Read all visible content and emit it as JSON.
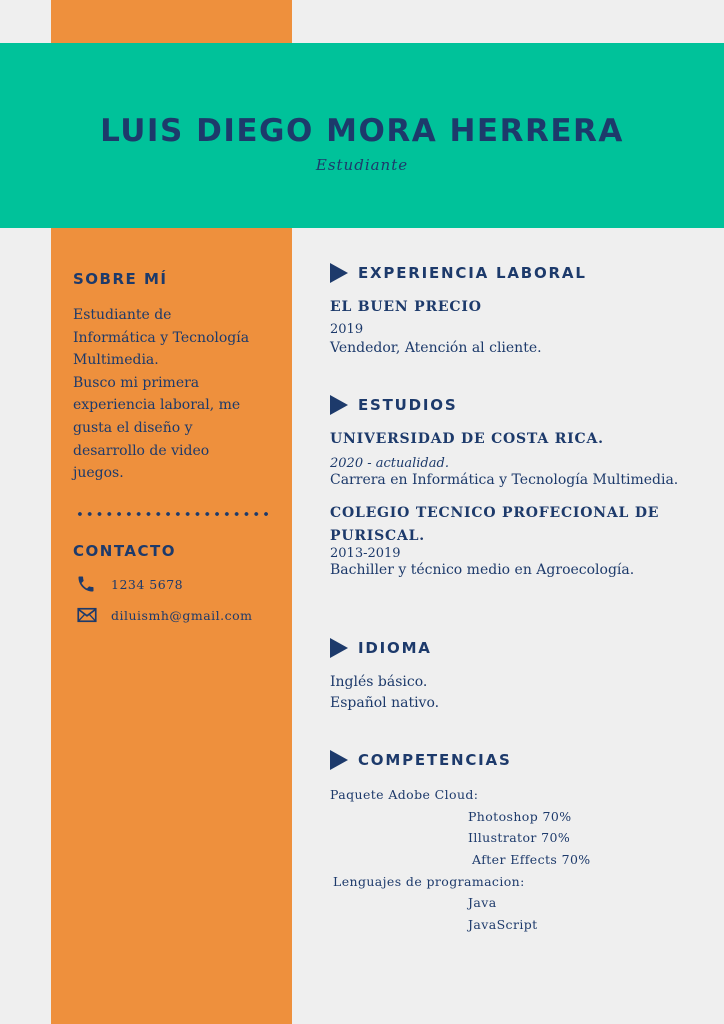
{
  "header": {
    "name": "LUIS DIEGO MORA HERRERA",
    "role": "Estudiante"
  },
  "sidebar": {
    "about_title": "SOBRE MÍ",
    "about_lines": [
      "Estudiante de",
      "Informática y Tecnología",
      "Multimedia.",
      "Busco mi primera",
      "experiencia laboral, me",
      "gusta el diseño y",
      "desarrollo de video",
      "juegos."
    ],
    "contact_title": "CONTACTO",
    "phone": "1234 5678",
    "email": "diluismh@gmail.com"
  },
  "experience": {
    "title": "EXPERIENCIA LABORAL",
    "org": "EL BUEN PRECIO",
    "year": "2019",
    "desc": "Vendedor, Atención al cliente."
  },
  "studies": {
    "title": "ESTUDIOS",
    "items": [
      {
        "org": "UNIVERSIDAD DE COSTA RICA.",
        "year": "2020 - actualidad.",
        "desc": "Carrera en Informática y Tecnología Multimedia."
      },
      {
        "org_line1": "COLEGIO TECNICO PROFECIONAL DE",
        "org_line2": "PURISCAL.",
        "year": "2013-2019",
        "desc": "Bachiller y técnico medio en Agroecología."
      }
    ]
  },
  "language": {
    "title": "IDIOMA",
    "lines": [
      "Inglés básico.",
      "Español nativo."
    ]
  },
  "skills": {
    "title": "COMPETENCIAS",
    "group1": "Paquete Adobe Cloud:",
    "adobe": [
      "Photoshop 70%",
      "Illustrator 70%",
      "After Effects 70%"
    ],
    "group2": "Lenguajes de programacion:",
    "langs": [
      "Java",
      "JavaScript"
    ]
  },
  "colors": {
    "orange": "#ee903d",
    "green": "#00c29a",
    "navy": "#1d3a6b",
    "background": "#efefef"
  },
  "icons": [
    "phone-icon",
    "mail-icon",
    "triangle-bullet-icon"
  ]
}
